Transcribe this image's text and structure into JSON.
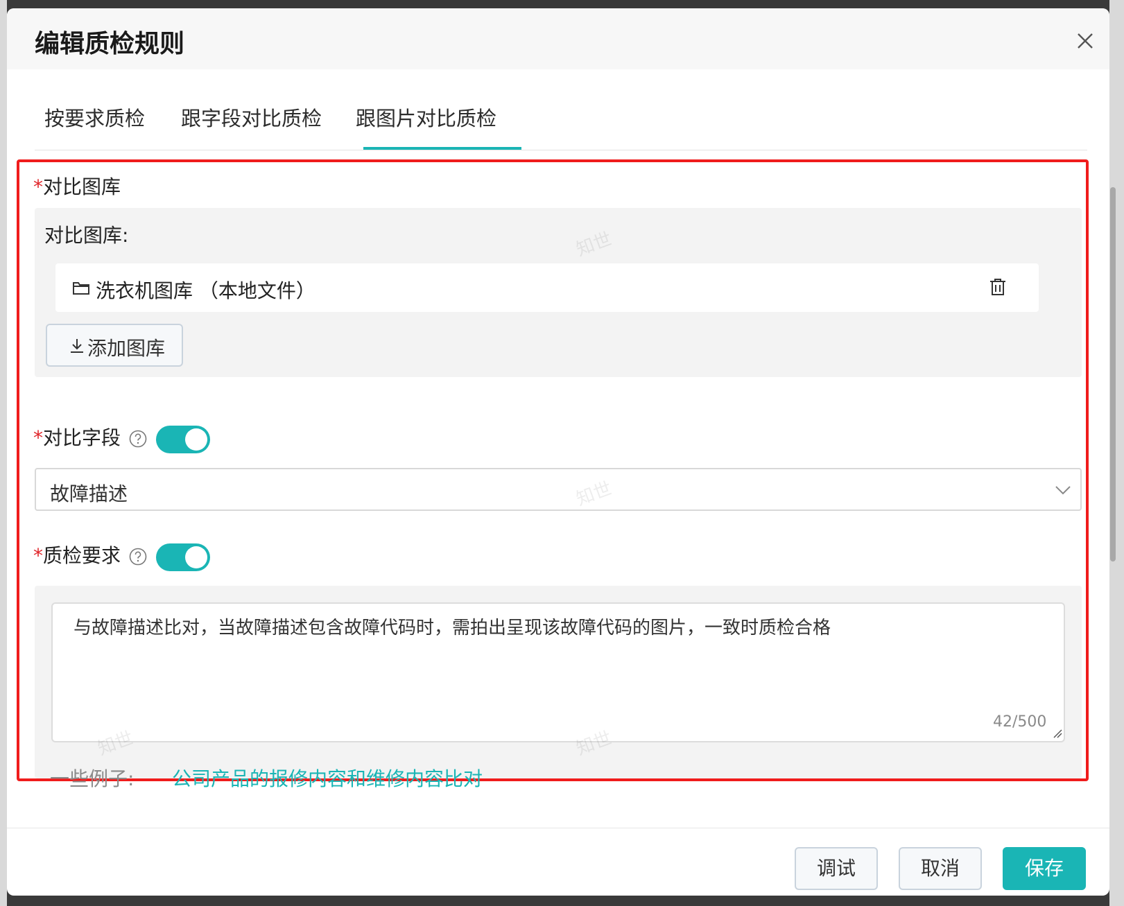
{
  "dialog": {
    "title": "编辑质检规则",
    "tabs": [
      {
        "label": "按要求质检"
      },
      {
        "label": "跟字段对比质检"
      },
      {
        "label": "跟图片对比质检"
      }
    ],
    "active_tab": "跟图片对比质检"
  },
  "gallery_section": {
    "required_mark": "*",
    "label": "对比图库",
    "inner_label": "对比图库:",
    "file": {
      "icon": "folder-icon",
      "name": "洗衣机图库 （本地文件）",
      "delete_icon": "trash-icon"
    },
    "add_button": {
      "icon": "download-icon",
      "label": "添加图库"
    }
  },
  "compare_field": {
    "required_mark": "*",
    "label": "对比字段",
    "help_icon": "question-circle-icon",
    "toggle_on": true,
    "select_value": "故障描述"
  },
  "qc_requirement": {
    "required_mark": "*",
    "label": "质检要求",
    "help_icon": "question-circle-icon",
    "toggle_on": true,
    "text": "与故障描述比对，当故障描述包含故障代码时，需拍出呈现该故障代码的图片，一致时质检合格",
    "counter": "42/500",
    "examples_label": "一些例子:",
    "example_link": "公司产品的报修内容和维修内容比对"
  },
  "footer": {
    "debug_label": "调试",
    "cancel_label": "取消",
    "save_label": "保存"
  },
  "watermark_text": "知世",
  "colors": {
    "accent": "#1ab5b5",
    "highlight_border": "#f01c1c",
    "required": "#e0262b"
  }
}
